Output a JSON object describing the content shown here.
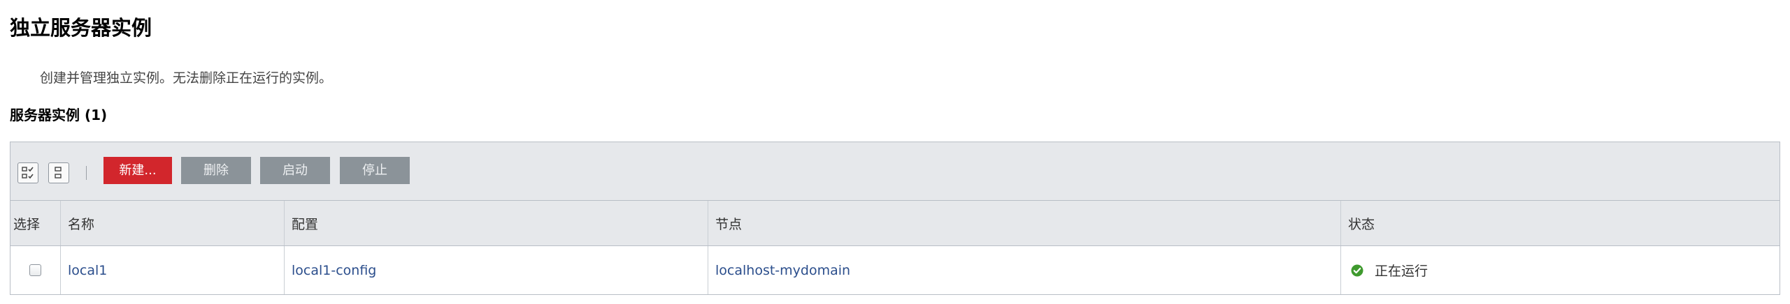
{
  "page": {
    "title": "独立服务器实例",
    "description": "创建并管理独立实例。无法删除正在运行的实例。",
    "section_title": "服务器实例 (1)"
  },
  "toolbar": {
    "select_all_icon": "select-all-icon",
    "deselect_all_icon": "deselect-all-icon",
    "new_label": "新建...",
    "delete_label": "删除",
    "start_label": "启动",
    "stop_label": "停止"
  },
  "table": {
    "columns": [
      "选择",
      "名称",
      "配置",
      "节点",
      "状态"
    ],
    "rows": [
      {
        "selected": false,
        "name": "local1",
        "config": "local1-config",
        "node": "localhost-mydomain",
        "status": "正在运行",
        "status_icon": "running-check-icon"
      }
    ]
  },
  "colors": {
    "primary_button": "#d2262c",
    "secondary_button": "#8b9399",
    "link": "#2b4e8c",
    "status_ok": "#3f9a2e"
  }
}
